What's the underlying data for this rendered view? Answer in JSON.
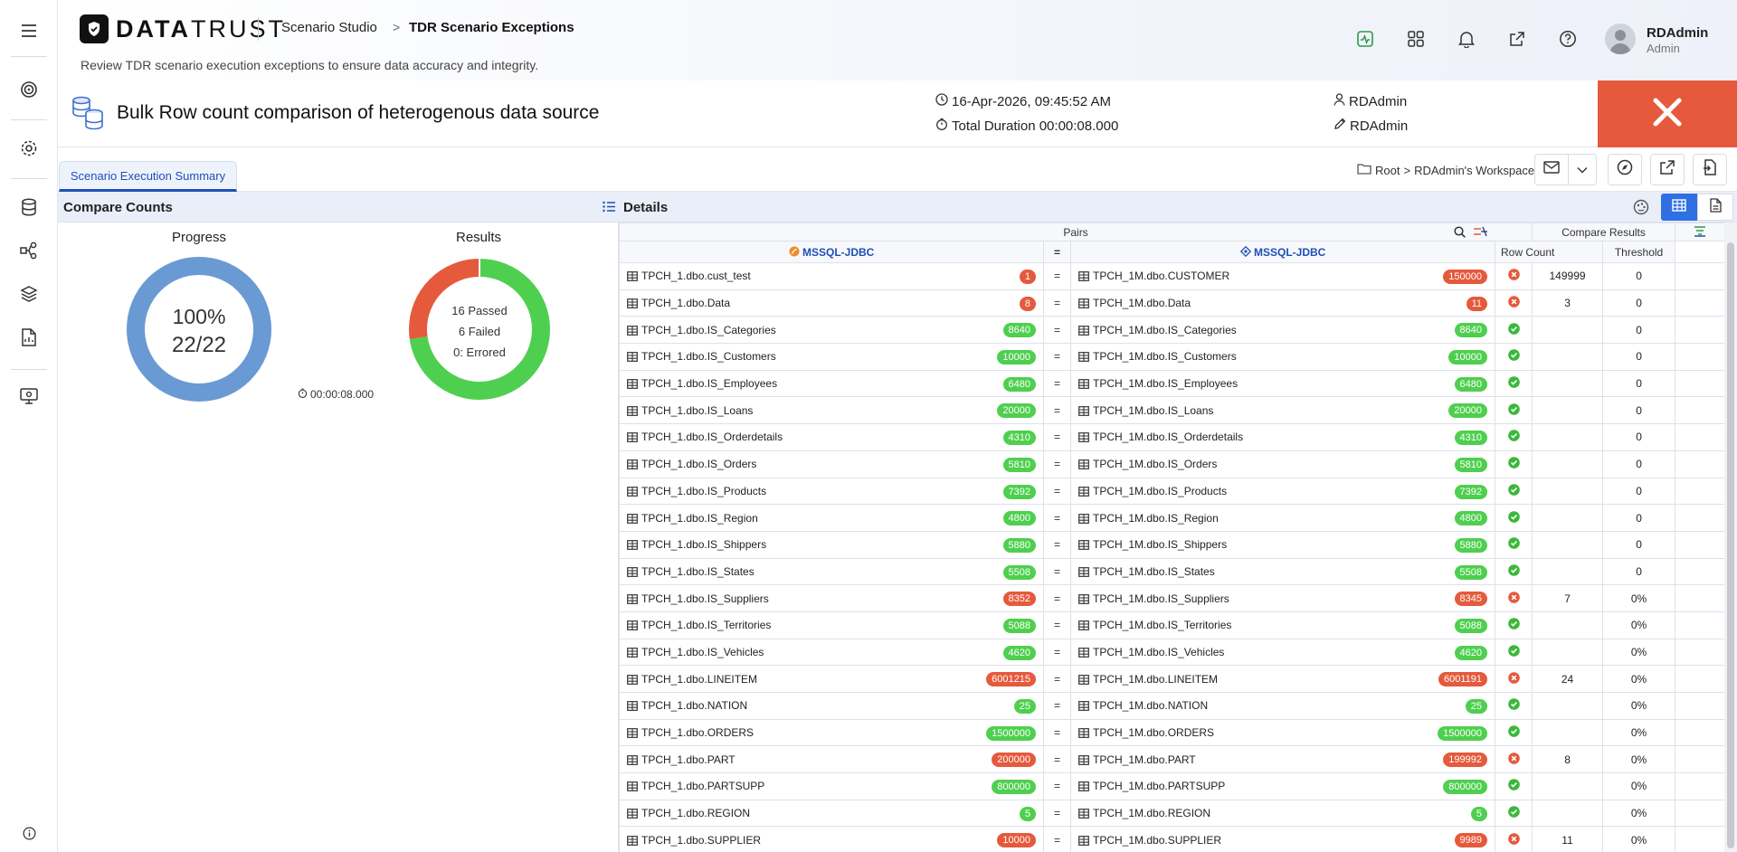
{
  "brand": {
    "name_bold": "DATA",
    "name_rest": "TRUST"
  },
  "breadcrumb": {
    "studio": "Scenario Studio",
    "sep": ">",
    "page": "TDR Scenario Exceptions"
  },
  "header": {
    "description": "Review TDR scenario execution exceptions to ensure data accuracy and integrity."
  },
  "user": {
    "name": "RDAdmin",
    "role": "Admin"
  },
  "scenario": {
    "title": "Bulk Row count comparison of heterogenous data source",
    "datetime": "16-Apr-2026, 09:45:52 AM",
    "duration": "Total Duration 00:00:08.000",
    "owner": "RDAdmin",
    "editor": "RDAdmin"
  },
  "tabs": {
    "summary": "Scenario Execution Summary"
  },
  "workspace": {
    "root": "Root",
    "sep": ">",
    "name": "RDAdmin's Workspace"
  },
  "compare_counts": {
    "title": "Compare Counts",
    "progress_label": "Progress",
    "progress_percent": "100%",
    "progress_count": "22/22",
    "progress_value": 1.0,
    "results_label": "Results",
    "passed": "16 Passed",
    "failed": "6 Failed",
    "errored": "0: Errored",
    "passed_value": 16,
    "failed_value": 6,
    "errored_value": 0,
    "duration": "00:00:08.000"
  },
  "details": {
    "title": "Details",
    "pairs_label": "Pairs",
    "compare_results_label": "Compare Results",
    "source_left": "MSSQL-JDBC",
    "source_right": "MSSQL-JDBC",
    "eq_header": "=",
    "col_row_count": "Row Count",
    "col_threshold": "Threshold",
    "rows": [
      {
        "left": "TPCH_1.dbo.cust_test",
        "lc": "1",
        "right": "TPCH_1M.dbo.CUSTOMER",
        "rc": "150000",
        "status": "fail",
        "diff": "149999",
        "thr": "0"
      },
      {
        "left": "TPCH_1.dbo.Data",
        "lc": "8",
        "right": "TPCH_1M.dbo.Data",
        "rc": "11",
        "status": "fail",
        "diff": "3",
        "thr": "0"
      },
      {
        "left": "TPCH_1.dbo.IS_Categories",
        "lc": "8640",
        "right": "TPCH_1M.dbo.IS_Categories",
        "rc": "8640",
        "status": "pass",
        "diff": "",
        "thr": "0"
      },
      {
        "left": "TPCH_1.dbo.IS_Customers",
        "lc": "10000",
        "right": "TPCH_1M.dbo.IS_Customers",
        "rc": "10000",
        "status": "pass",
        "diff": "",
        "thr": "0"
      },
      {
        "left": "TPCH_1.dbo.IS_Employees",
        "lc": "6480",
        "right": "TPCH_1M.dbo.IS_Employees",
        "rc": "6480",
        "status": "pass",
        "diff": "",
        "thr": "0"
      },
      {
        "left": "TPCH_1.dbo.IS_Loans",
        "lc": "20000",
        "right": "TPCH_1M.dbo.IS_Loans",
        "rc": "20000",
        "status": "pass",
        "diff": "",
        "thr": "0"
      },
      {
        "left": "TPCH_1.dbo.IS_Orderdetails",
        "lc": "4310",
        "right": "TPCH_1M.dbo.IS_Orderdetails",
        "rc": "4310",
        "status": "pass",
        "diff": "",
        "thr": "0"
      },
      {
        "left": "TPCH_1.dbo.IS_Orders",
        "lc": "5810",
        "right": "TPCH_1M.dbo.IS_Orders",
        "rc": "5810",
        "status": "pass",
        "diff": "",
        "thr": "0"
      },
      {
        "left": "TPCH_1.dbo.IS_Products",
        "lc": "7392",
        "right": "TPCH_1M.dbo.IS_Products",
        "rc": "7392",
        "status": "pass",
        "diff": "",
        "thr": "0"
      },
      {
        "left": "TPCH_1.dbo.IS_Region",
        "lc": "4800",
        "right": "TPCH_1M.dbo.IS_Region",
        "rc": "4800",
        "status": "pass",
        "diff": "",
        "thr": "0"
      },
      {
        "left": "TPCH_1.dbo.IS_Shippers",
        "lc": "5880",
        "right": "TPCH_1M.dbo.IS_Shippers",
        "rc": "5880",
        "status": "pass",
        "diff": "",
        "thr": "0"
      },
      {
        "left": "TPCH_1.dbo.IS_States",
        "lc": "5508",
        "right": "TPCH_1M.dbo.IS_States",
        "rc": "5508",
        "status": "pass",
        "diff": "",
        "thr": "0"
      },
      {
        "left": "TPCH_1.dbo.IS_Suppliers",
        "lc": "8352",
        "right": "TPCH_1M.dbo.IS_Suppliers",
        "rc": "8345",
        "status": "fail",
        "diff": "7",
        "thr": "0%"
      },
      {
        "left": "TPCH_1.dbo.IS_Territories",
        "lc": "5088",
        "right": "TPCH_1M.dbo.IS_Territories",
        "rc": "5088",
        "status": "pass",
        "diff": "",
        "thr": "0%"
      },
      {
        "left": "TPCH_1.dbo.IS_Vehicles",
        "lc": "4620",
        "right": "TPCH_1M.dbo.IS_Vehicles",
        "rc": "4620",
        "status": "pass",
        "diff": "",
        "thr": "0%"
      },
      {
        "left": "TPCH_1.dbo.LINEITEM",
        "lc": "6001215",
        "right": "TPCH_1M.dbo.LINEITEM",
        "rc": "6001191",
        "status": "fail",
        "diff": "24",
        "thr": "0%"
      },
      {
        "left": "TPCH_1.dbo.NATION",
        "lc": "25",
        "right": "TPCH_1M.dbo.NATION",
        "rc": "25",
        "status": "pass",
        "diff": "",
        "thr": "0%"
      },
      {
        "left": "TPCH_1.dbo.ORDERS",
        "lc": "1500000",
        "right": "TPCH_1M.dbo.ORDERS",
        "rc": "1500000",
        "status": "pass",
        "diff": "",
        "thr": "0%"
      },
      {
        "left": "TPCH_1.dbo.PART",
        "lc": "200000",
        "right": "TPCH_1M.dbo.PART",
        "rc": "199992",
        "status": "fail",
        "diff": "8",
        "thr": "0%"
      },
      {
        "left": "TPCH_1.dbo.PARTSUPP",
        "lc": "800000",
        "right": "TPCH_1M.dbo.PARTSUPP",
        "rc": "800000",
        "status": "pass",
        "diff": "",
        "thr": "0%"
      },
      {
        "left": "TPCH_1.dbo.REGION",
        "lc": "5",
        "right": "TPCH_1M.dbo.REGION",
        "rc": "5",
        "status": "pass",
        "diff": "",
        "thr": "0%"
      },
      {
        "left": "TPCH_1.dbo.SUPPLIER",
        "lc": "10000",
        "right": "TPCH_1M.dbo.SUPPLIER",
        "rc": "9989",
        "status": "fail",
        "diff": "11",
        "thr": "0%"
      }
    ]
  },
  "colors": {
    "accent": "#1f4fb5",
    "pass": "#4fcf4f",
    "fail": "#e55a3c",
    "progress": "#6a9ad4"
  },
  "icons": [
    "menu-icon",
    "target-icon",
    "gear-icon",
    "database-icon",
    "workflow-icon",
    "layers-icon",
    "report-icon",
    "monitor-icon",
    "info-icon",
    "activity-icon",
    "grid-icon",
    "bell-icon",
    "external-link-icon",
    "help-icon",
    "clock-icon",
    "user-icon",
    "pencil-icon",
    "close-icon",
    "folder-icon",
    "mail-icon",
    "chevron-down-icon",
    "compass-icon",
    "export-icon",
    "document-icon",
    "list-icon",
    "palette-icon",
    "table-view-icon",
    "file-view-icon",
    "search-icon",
    "compare-icon",
    "filter-icon"
  ]
}
